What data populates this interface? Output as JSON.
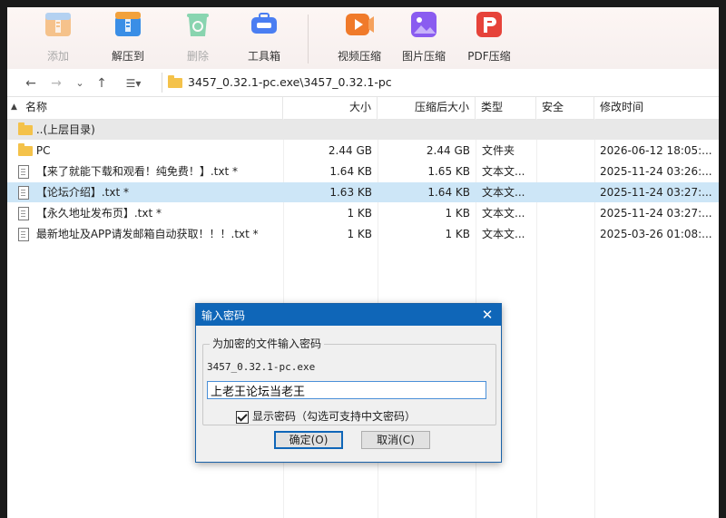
{
  "toolbar": {
    "items": [
      {
        "label": "添加",
        "icon": "archive-add-icon",
        "color": "#f29b38",
        "disabled": true
      },
      {
        "label": "解压到",
        "icon": "archive-extract-icon",
        "color": "#3a8ee6",
        "disabled": false
      },
      {
        "label": "删除",
        "icon": "recycle-icon",
        "color": "#2dbb7a",
        "disabled": true
      },
      {
        "label": "工具箱",
        "icon": "toolbox-icon",
        "color": "#4a7ef2",
        "disabled": false
      },
      {
        "label": "视频压缩",
        "icon": "video-compress-icon",
        "color": "#f07a2a",
        "disabled": false
      },
      {
        "label": "图片压缩",
        "icon": "image-compress-icon",
        "color": "#8a5cf0",
        "disabled": false
      },
      {
        "label": "PDF压缩",
        "icon": "pdf-compress-icon",
        "color": "#e6433a",
        "disabled": false
      }
    ]
  },
  "address": {
    "path": "3457_0.32.1-pc.exe\\3457_0.32.1-pc"
  },
  "columns": {
    "name": "名称",
    "size": "大小",
    "packed": "压缩后大小",
    "type": "类型",
    "security": "安全",
    "modified": "修改时间"
  },
  "rows": [
    {
      "name": "..(上层目录)",
      "size": "",
      "packed": "",
      "type": "",
      "modified": ""
    },
    {
      "name": "PC",
      "size": "2.44 GB",
      "packed": "2.44 GB",
      "type": "文件夹",
      "modified": "2026-06-12 18:05:..."
    },
    {
      "name": "【来了就能下载和观看！纯免费！】.txt *",
      "size": "1.64 KB",
      "packed": "1.65 KB",
      "type": "文本文...",
      "modified": "2025-11-24 03:26:..."
    },
    {
      "name": "【论坛介绍】.txt *",
      "size": "1.63 KB",
      "packed": "1.64 KB",
      "type": "文本文...",
      "modified": "2025-11-24 03:27:..."
    },
    {
      "name": "【永久地址发布页】.txt *",
      "size": "1 KB",
      "packed": "1 KB",
      "type": "文本文...",
      "modified": "2025-11-24 03:27:..."
    },
    {
      "name": "最新地址及APP请发邮箱自动获取！！！.txt *",
      "size": "1 KB",
      "packed": "1 KB",
      "type": "文本文...",
      "modified": "2025-03-26 01:08:..."
    }
  ],
  "dialog": {
    "title": "输入密码",
    "group_label": "为加密的文件输入密码",
    "archive_name": "3457_0.32.1-pc.exe",
    "password_value": "上老王论坛当老王",
    "show_password_label": "显示密码（勾选可支持中文密码）",
    "show_password_checked": true,
    "ok_label": "确定(O)",
    "cancel_label": "取消(C)"
  }
}
